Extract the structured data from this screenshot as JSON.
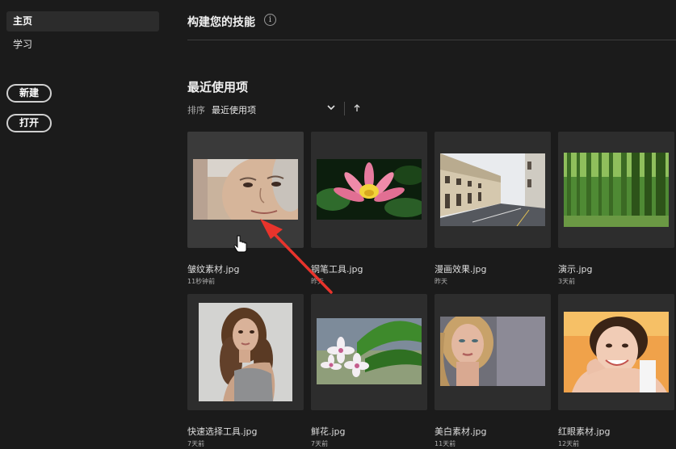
{
  "sidebar": {
    "items": [
      {
        "label": "主页",
        "active": true
      },
      {
        "label": "学习",
        "active": false
      }
    ],
    "new_button": "新建",
    "open_button": "打开"
  },
  "main": {
    "build_skills_title": "构建您的技能",
    "info_icon_glyph": "i",
    "recent_title": "最近使用项",
    "sort_label": "排序",
    "sort_value": "最近使用项",
    "files": [
      {
        "name": "皱纹素材.jpg",
        "time": "11秒钟前",
        "thumb": "portrait-elderly-woman"
      },
      {
        "name": "钢笔工具.jpg",
        "time": "昨天",
        "thumb": "pink-lotus"
      },
      {
        "name": "漫画效果.jpg",
        "time": "昨天",
        "thumb": "street-buildings"
      },
      {
        "name": "演示.jpg",
        "time": "3天前",
        "thumb": "bamboo-forest"
      },
      {
        "name": "快速选择工具.jpg",
        "time": "7天前",
        "thumb": "woman-curly-hair"
      },
      {
        "name": "鲜花.jpg",
        "time": "7天前",
        "thumb": "plumeria-flowers"
      },
      {
        "name": "美白素材.jpg",
        "time": "11天前",
        "thumb": "blonde-woman-portrait"
      },
      {
        "name": "红眼素材.jpg",
        "time": "12天前",
        "thumb": "smiling-woman-orange"
      }
    ]
  },
  "annotation": {
    "color": "#e8342c",
    "icon": "red-arrow-pointer"
  },
  "cursor": {
    "icon": "hand-pointer-cursor"
  }
}
